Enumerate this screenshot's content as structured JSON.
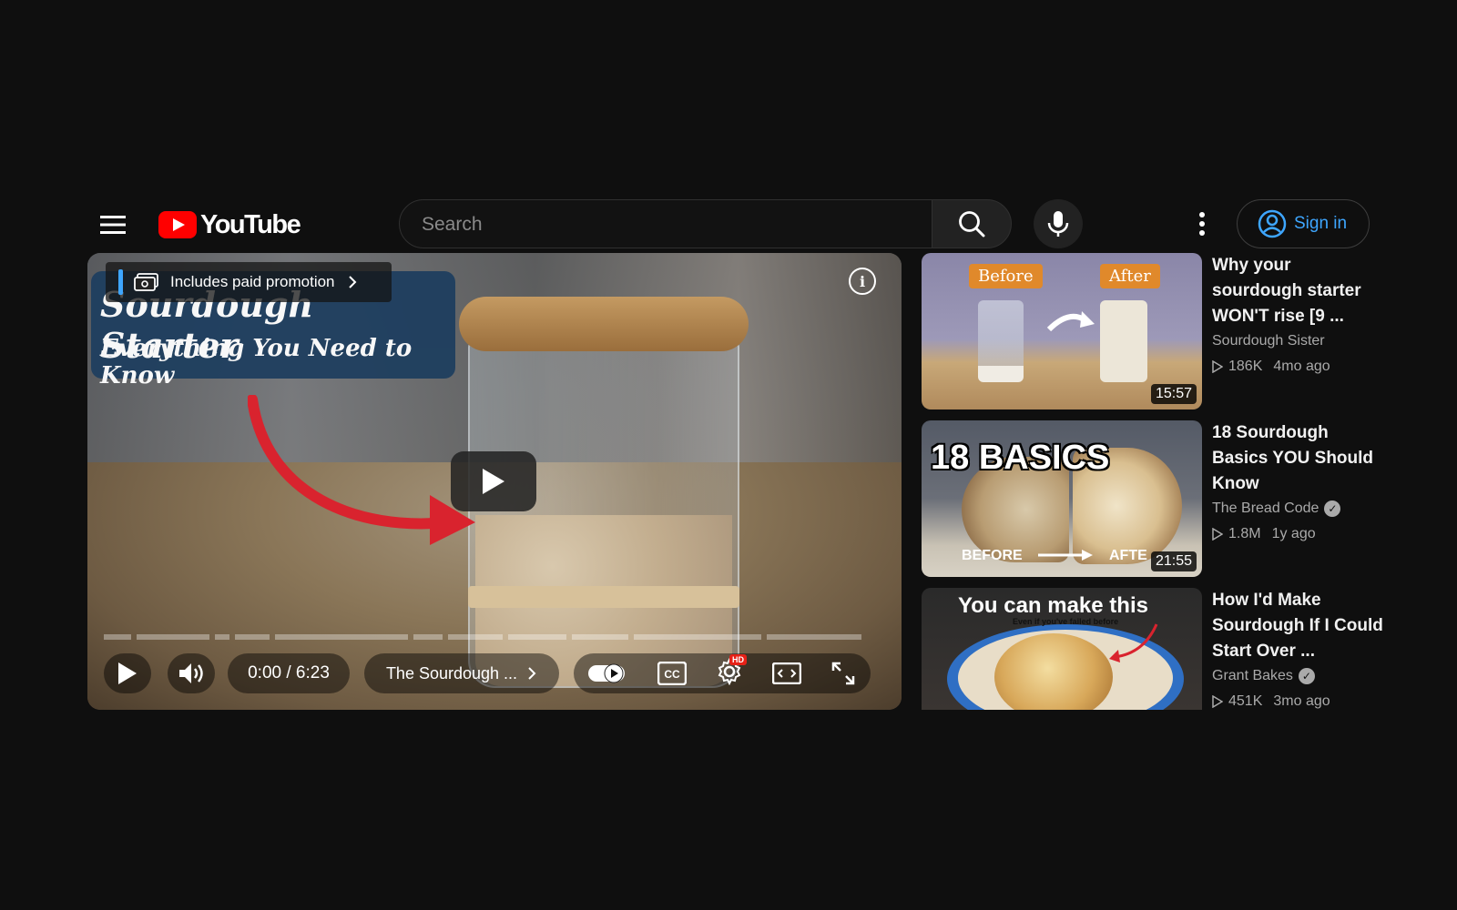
{
  "header": {
    "logo_text": "YouTube",
    "search_placeholder": "Search",
    "signin_label": "Sign in"
  },
  "player": {
    "title_card_line1": "Sourdough Starter",
    "title_card_line2": "Everything You Need to Know",
    "paid_promotion": "Includes paid promotion",
    "time": "0:00 / 6:23",
    "chapter": "The Sourdough ...",
    "hd_badge": "HD"
  },
  "sidebar": {
    "videos": [
      {
        "title": "Why your sourdough starter WON'T rise [9 ...",
        "channel": "Sourdough Sister",
        "verified": false,
        "views": "186K",
        "age": "4mo ago",
        "duration": "15:57",
        "thumb_text_a": "Before",
        "thumb_text_b": "After"
      },
      {
        "title": "18 Sourdough Basics YOU Should Know",
        "channel": "The Bread Code",
        "verified": true,
        "views": "1.8M",
        "age": "1y ago",
        "duration": "21:55",
        "thumb_text_a": "18 BASICS",
        "thumb_text_b": "BEFORE",
        "thumb_text_c": "AFTE"
      },
      {
        "title": "How I'd Make Sourdough If I Could Start Over ...",
        "channel": "Grant Bakes",
        "verified": true,
        "views": "451K",
        "age": "3mo ago",
        "thumb_text_a": "You can make this",
        "thumb_text_b": "Even if you've failed before"
      }
    ]
  },
  "colors": {
    "background": "#0f0f0f",
    "accent_blue": "#3ea6ff",
    "youtube_red": "#ff0000"
  }
}
